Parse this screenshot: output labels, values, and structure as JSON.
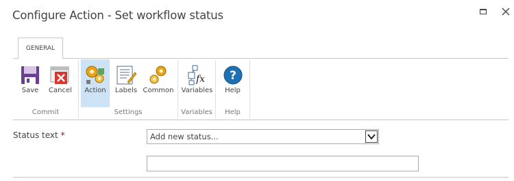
{
  "dialog": {
    "title": "Configure Action - Set workflow status"
  },
  "window_controls": {
    "maximize_icon": "maximize-icon",
    "close_icon": "close-icon"
  },
  "ribbon": {
    "tabs": [
      {
        "label": "GENERAL",
        "active": true
      }
    ],
    "groups": {
      "commit": {
        "label": "Commit",
        "buttons": [
          {
            "label": "Save",
            "icon": "save-icon"
          },
          {
            "label": "Cancel",
            "icon": "cancel-icon"
          }
        ]
      },
      "settings": {
        "label": "Settings",
        "buttons": [
          {
            "label": "Action",
            "icon": "action-gears-icon",
            "selected": true
          },
          {
            "label": "Labels",
            "icon": "labels-icon"
          },
          {
            "label": "Common",
            "icon": "common-gears-icon"
          }
        ]
      },
      "variables": {
        "label": "Variables",
        "buttons": [
          {
            "label": "Variables",
            "icon": "variables-icon"
          }
        ]
      },
      "help": {
        "label": "Help",
        "buttons": [
          {
            "label": "Help",
            "icon": "help-icon"
          }
        ]
      }
    }
  },
  "form": {
    "status_text": {
      "label": "Status text",
      "required_marker": "*",
      "selected_value": "Add new status...",
      "new_status_value": ""
    }
  },
  "colors": {
    "selected_button_bg": "#cde3f5",
    "required_marker": "#bf0000",
    "border": "#c6c6c6",
    "help_blue": "#1f6fb3",
    "cancel_red": "#d9362f",
    "save_purple": "#6b3f8f",
    "gear_orange": "#e8a317"
  }
}
